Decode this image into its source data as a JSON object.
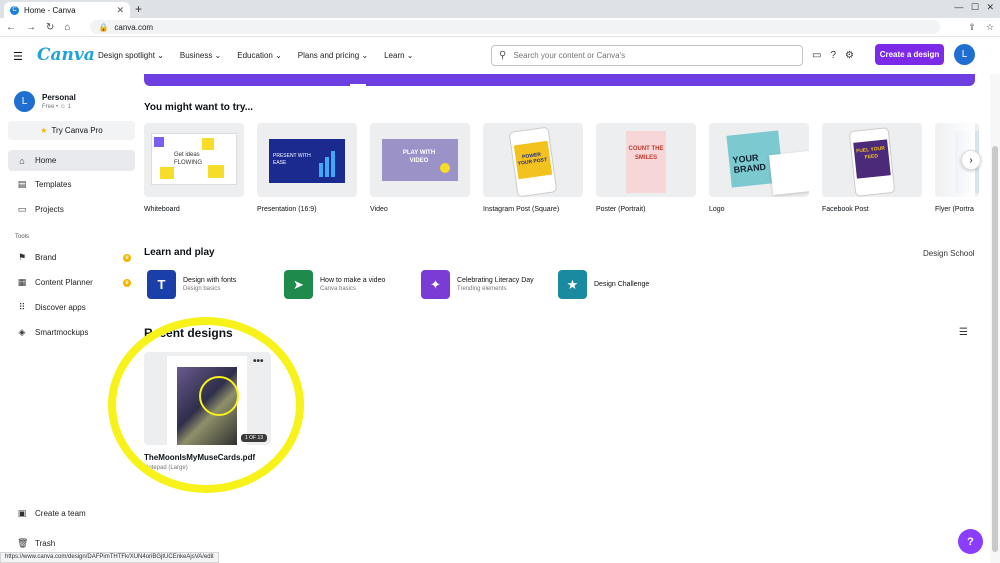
{
  "browser": {
    "tab_title": "Home - Canva",
    "favicon_letter": "C",
    "url": "canva.com",
    "status_url": "https://www.canva.com/design/DAFPimTHTFk/XUN4oriBGjtUCEnkeAjsVA/edit"
  },
  "header": {
    "logo": "Canva",
    "nav": [
      "Design spotlight",
      "Business",
      "Education",
      "Plans and pricing",
      "Learn"
    ],
    "search_placeholder": "Search your content or Canva's",
    "create_label": "Create a design",
    "avatar_letter": "L"
  },
  "sidebar": {
    "profile_name": "Personal",
    "profile_sub": "Free • ☺ 1",
    "try_pro": "Try Canva Pro",
    "items": [
      {
        "label": "Home",
        "icon": "home-icon"
      },
      {
        "label": "Templates",
        "icon": "templates-icon"
      },
      {
        "label": "Projects",
        "icon": "folder-icon"
      }
    ],
    "tools_label": "Tools",
    "tools": [
      {
        "label": "Brand",
        "icon": "brand-icon"
      },
      {
        "label": "Content Planner",
        "icon": "calendar-icon"
      },
      {
        "label": "Discover apps",
        "icon": "apps-icon"
      },
      {
        "label": "Smartmockups",
        "icon": "mockups-icon"
      }
    ],
    "create_team": "Create a team",
    "trash": "Trash"
  },
  "main": {
    "try_heading": "You might want to try...",
    "tries": [
      "Whiteboard",
      "Presentation (16:9)",
      "Video",
      "Instagram Post (Square)",
      "Poster (Portrait)",
      "Logo",
      "Facebook Post",
      "Flyer (Portra"
    ],
    "thumb_text": {
      "whiteboard": "Get ideas FLOWING",
      "presentation": "PRESENT WITH EASE",
      "video": "PLAY WITH VIDEO",
      "instagram": "POWER YOUR POST",
      "poster": "COUNT THE SMILES",
      "logo": "YOUR BRAND",
      "facebook": "FUEL YOUR FEED"
    },
    "learn_heading": "Learn and play",
    "design_school": "Design School",
    "learn_items": [
      {
        "title": "Design with fonts",
        "sub": "Design basics",
        "color": "#1a3fa8",
        "glyph": "T"
      },
      {
        "title": "How to make a video",
        "sub": "Canva basics",
        "color": "#1e8a4c",
        "glyph": "➤"
      },
      {
        "title": "Celebrating Literacy Day",
        "sub": "Trending elements",
        "color": "#7b3cd6",
        "glyph": "✦"
      },
      {
        "title": "Design Challenge",
        "sub": "",
        "color": "#1a8aa0",
        "glyph": "★"
      }
    ],
    "recent_heading": "Recent designs",
    "recent": {
      "title": "TheMoonIsMyMuseCards.pdf",
      "sub": "Notepad (Large)",
      "pages": "1 OF 13"
    }
  },
  "colors": {
    "brand_purple": "#7d2ae8",
    "logo_blue": "#1fa2d8",
    "highlight_yellow": "#f6f21a"
  }
}
